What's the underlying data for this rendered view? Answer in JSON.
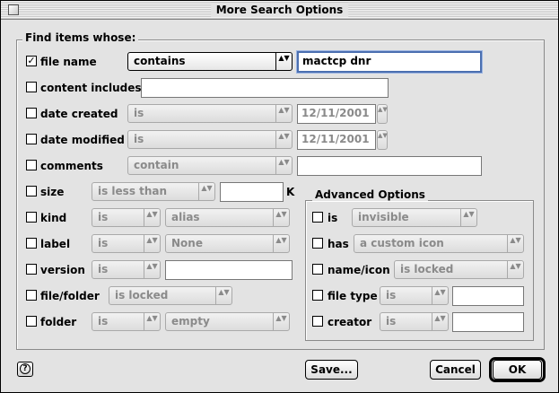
{
  "window": {
    "title": "More Search Options"
  },
  "find_group": {
    "label": "Find items whose:"
  },
  "criteria": {
    "file_name": {
      "label": "file name",
      "checked": true,
      "operator": "contains",
      "value": "mactcp dnr"
    },
    "content_includes": {
      "label": "content includes",
      "checked": false,
      "value": ""
    },
    "date_created": {
      "label": "date created",
      "checked": false,
      "operator": "is",
      "value": "12/11/2001"
    },
    "date_modified": {
      "label": "date modified",
      "checked": false,
      "operator": "is",
      "value": "12/11/2001"
    },
    "comments": {
      "label": "comments",
      "checked": false,
      "operator": "contain",
      "value": ""
    },
    "size": {
      "label": "size",
      "checked": false,
      "operator": "is less than",
      "value": "",
      "unit": "K"
    },
    "kind": {
      "label": "kind",
      "checked": false,
      "operator": "is",
      "value": "alias"
    },
    "label": {
      "label": "label",
      "checked": false,
      "operator": "is",
      "value": "None"
    },
    "version": {
      "label": "version",
      "checked": false,
      "operator": "is",
      "value": ""
    },
    "file_folder": {
      "label": "file/folder",
      "checked": false,
      "operator": "is locked"
    },
    "folder": {
      "label": "folder",
      "checked": false,
      "operator": "is",
      "value": "empty"
    }
  },
  "advanced": {
    "label": "Advanced Options",
    "is": {
      "label": "is",
      "checked": false,
      "value": "invisible"
    },
    "has": {
      "label": "has",
      "checked": false,
      "value": "a custom icon"
    },
    "name_icon": {
      "label": "name/icon",
      "checked": false,
      "value": "is locked"
    },
    "file_type": {
      "label": "file type",
      "checked": false,
      "operator": "is",
      "value": ""
    },
    "creator": {
      "label": "creator",
      "checked": false,
      "operator": "is",
      "value": ""
    }
  },
  "buttons": {
    "save": "Save...",
    "cancel": "Cancel",
    "ok": "OK",
    "help": "?"
  },
  "glyphs": {
    "check": "✓",
    "updown": "▲▼",
    "up": "▲",
    "down": "▼"
  }
}
